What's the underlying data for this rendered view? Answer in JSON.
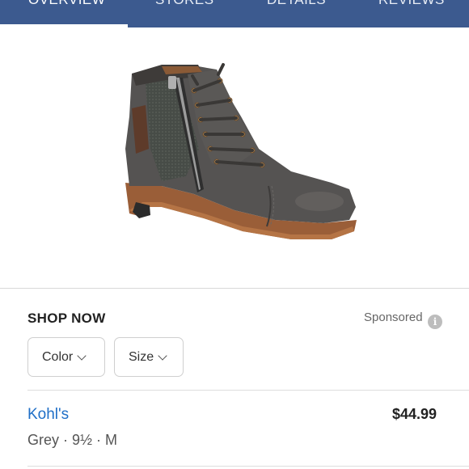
{
  "tabs": [
    {
      "label": "OVERVIEW",
      "active": true
    },
    {
      "label": "STORES",
      "active": false
    },
    {
      "label": "DETAILS",
      "active": false
    },
    {
      "label": "REVIEWS",
      "active": false
    }
  ],
  "product_image": {
    "icon": "boot-image"
  },
  "shop": {
    "title": "SHOP NOW",
    "sponsored_label": "Sponsored",
    "info_icon": "i"
  },
  "filters": {
    "color_label": "Color",
    "size_label": "Size"
  },
  "offer": {
    "retailer": "Kohl's",
    "price": "$44.99",
    "details": "Grey · 9½ · M"
  },
  "colors": {
    "tabbar": "#3c5a8f",
    "link": "#1f6fc7"
  }
}
